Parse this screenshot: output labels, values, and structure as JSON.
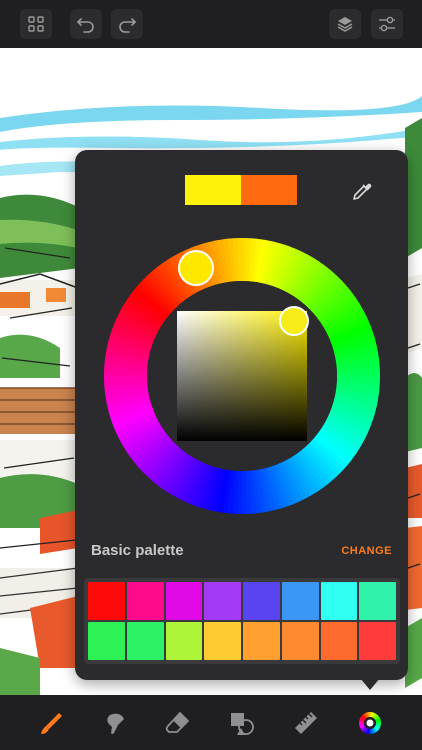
{
  "toolbar": {
    "icons": [
      "grid-icon",
      "undo-icon",
      "redo-icon",
      "layers-icon",
      "sliders-icon"
    ]
  },
  "color_picker": {
    "current_color": "#FFF20A",
    "previous_color": "#FF6A10",
    "hue_color": "#FFF000",
    "palette_label": "Basic palette",
    "change_label": "CHANGE",
    "palette": [
      "#FF0A0A",
      "#FF0A8C",
      "#E10AE6",
      "#A33BF5",
      "#5A44F0",
      "#3C96F5",
      "#30FFF2",
      "#30F2AA",
      "#2EF255",
      "#2EF266",
      "#AEF53A",
      "#FFCC33",
      "#FF9F30",
      "#FF8A30",
      "#FF6A2E",
      "#FF3B3B"
    ]
  },
  "bottom_tools": {
    "items": [
      "brush-icon",
      "smudge-icon",
      "eraser-icon",
      "shapes-icon",
      "ruler-icon",
      "color-wheel-icon"
    ],
    "active": "brush-icon",
    "accent": "#FF7A1A"
  }
}
